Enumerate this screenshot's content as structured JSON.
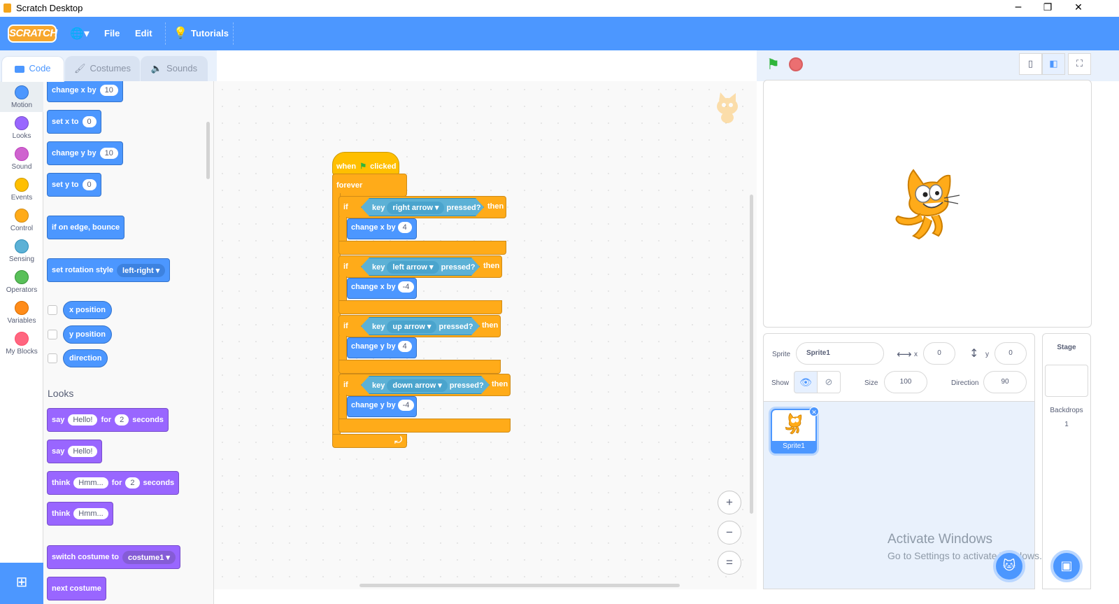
{
  "window": {
    "title": "Scratch Desktop",
    "minimize": "─",
    "maximize": "❐",
    "close": "✕"
  },
  "menubar": {
    "logo": "SCRATCH",
    "globe": "🌐▾",
    "file": "File",
    "edit": "Edit",
    "tutorials": "Tutorials"
  },
  "tabs": {
    "code": "Code",
    "costumes": "Costumes",
    "sounds": "Sounds"
  },
  "categories": [
    {
      "label": "Motion",
      "color": "#4c97ff"
    },
    {
      "label": "Looks",
      "color": "#9966ff"
    },
    {
      "label": "Sound",
      "color": "#cf63cf"
    },
    {
      "label": "Events",
      "color": "#ffbf00"
    },
    {
      "label": "Control",
      "color": "#ffab19"
    },
    {
      "label": "Sensing",
      "color": "#5cb1d6"
    },
    {
      "label": "Operators",
      "color": "#59c059"
    },
    {
      "label": "Variables",
      "color": "#ff8c1a"
    },
    {
      "label": "My Blocks",
      "color": "#ff6680"
    }
  ],
  "palette": {
    "change_x": {
      "text": "change x by",
      "value": "10"
    },
    "set_x": {
      "text": "set x to",
      "value": "0"
    },
    "change_y": {
      "text": "change y by",
      "value": "10"
    },
    "set_y": {
      "text": "set y to",
      "value": "0"
    },
    "bounce": "if on edge, bounce",
    "rotation": {
      "text": "set rotation style",
      "value": "left-right"
    },
    "x_position": "x position",
    "y_position": "y position",
    "direction": "direction",
    "looks_heading": "Looks",
    "say_for": {
      "say": "say",
      "msg": "Hello!",
      "for": "for",
      "secs": "2",
      "seconds": "seconds"
    },
    "say": {
      "say": "say",
      "msg": "Hello!"
    },
    "think_for": {
      "think": "think",
      "msg": "Hmm...",
      "for": "for",
      "secs": "2",
      "seconds": "seconds"
    },
    "think": {
      "think": "think",
      "msg": "Hmm..."
    },
    "switch_costume": {
      "text": "switch costume to",
      "value": "costume1"
    },
    "next_costume": "next costume"
  },
  "script": {
    "hat": {
      "when": "when",
      "clicked": "clicked"
    },
    "forever": "forever",
    "ifs": [
      {
        "if": "if",
        "key": "key",
        "option": "right arrow",
        "pressed": "pressed?",
        "then": "then",
        "action": "change x by",
        "value": "4"
      },
      {
        "if": "if",
        "key": "key",
        "option": "left arrow",
        "pressed": "pressed?",
        "then": "then",
        "action": "change x by",
        "value": "-4"
      },
      {
        "if": "if",
        "key": "key",
        "option": "up arrow",
        "pressed": "pressed?",
        "then": "then",
        "action": "change y by",
        "value": "4"
      },
      {
        "if": "if",
        "key": "key",
        "option": "down arrow",
        "pressed": "pressed?",
        "then": "then",
        "action": "change y by",
        "value": "-4"
      }
    ],
    "loop_arrow": "⤾"
  },
  "zoom": {
    "in": "+",
    "out": "−",
    "reset": "="
  },
  "sprite_info": {
    "sprite_label": "Sprite",
    "sprite_name": "Sprite1",
    "x_label": "x",
    "x": "0",
    "y_label": "y",
    "y": "0",
    "show_label": "Show",
    "size_label": "Size",
    "size": "100",
    "direction_label": "Direction",
    "direction": "90"
  },
  "sprite_list": [
    {
      "name": "Sprite1"
    }
  ],
  "stage_panel": {
    "title": "Stage",
    "backdrops_label": "Backdrops",
    "backdrops_count": "1"
  },
  "watermark": {
    "line1": "Activate Windows",
    "line2": "Go to Settings to activate Windows."
  }
}
